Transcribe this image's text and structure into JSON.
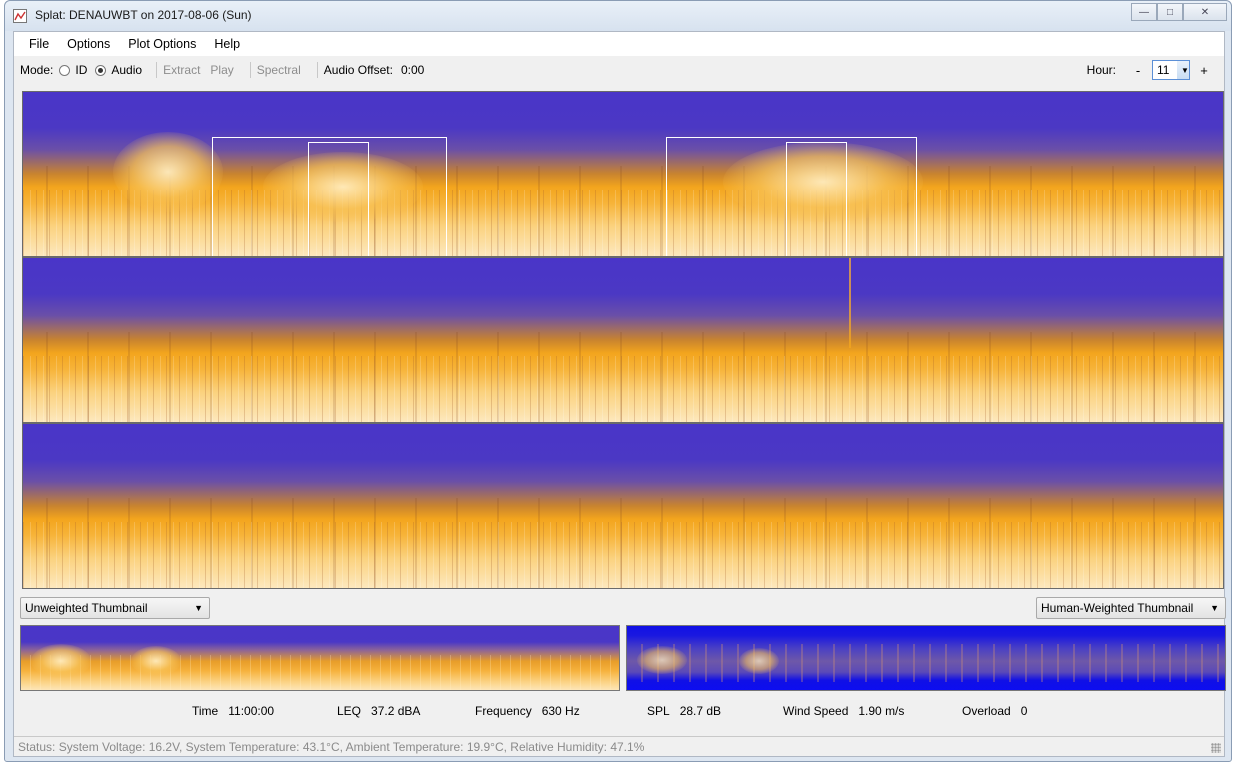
{
  "window": {
    "title": "Splat: DENAUWBT on 2017-08-06 (Sun)",
    "buttons": {
      "minimize": "—",
      "maximize": "□",
      "close": "✕"
    }
  },
  "menu": [
    "File",
    "Options",
    "Plot Options",
    "Help"
  ],
  "toolbar": {
    "mode_label": "Mode:",
    "mode_id": "ID",
    "mode_audio": "Audio",
    "selected_mode": "Audio",
    "extract": "Extract",
    "play": "Play",
    "spectral": "Spectral",
    "audio_offset_label": "Audio Offset:",
    "audio_offset_value": "0:00",
    "hour_label": "Hour:",
    "hour_minus": "-",
    "hour_value": "11",
    "hour_plus": "+"
  },
  "thumbnails": {
    "left_select": "Unweighted Thumbnail",
    "right_select": "Human-Weighted Thumbnail"
  },
  "readouts": {
    "time_label": "Time",
    "time_value": "11:00:00",
    "leq_label": "LEQ",
    "leq_value": "37.2 dBA",
    "freq_label": "Frequency",
    "freq_value": "630 Hz",
    "spl_label": "SPL",
    "spl_value": "28.7 dB",
    "wind_label": "Wind Speed",
    "wind_value": "1.90 m/s",
    "overload_label": "Overload",
    "overload_value": "0"
  },
  "status": "Status: System Voltage: 16.2V, System Temperature: 43.1°C, Ambient Temperature: 19.9°C, Relative Humidity: 47.1%",
  "colors": {
    "spectrogram_low": "#4a35c8",
    "spectrogram_high": "#f3a51d",
    "human_weighted_bg": "#1010e6"
  }
}
